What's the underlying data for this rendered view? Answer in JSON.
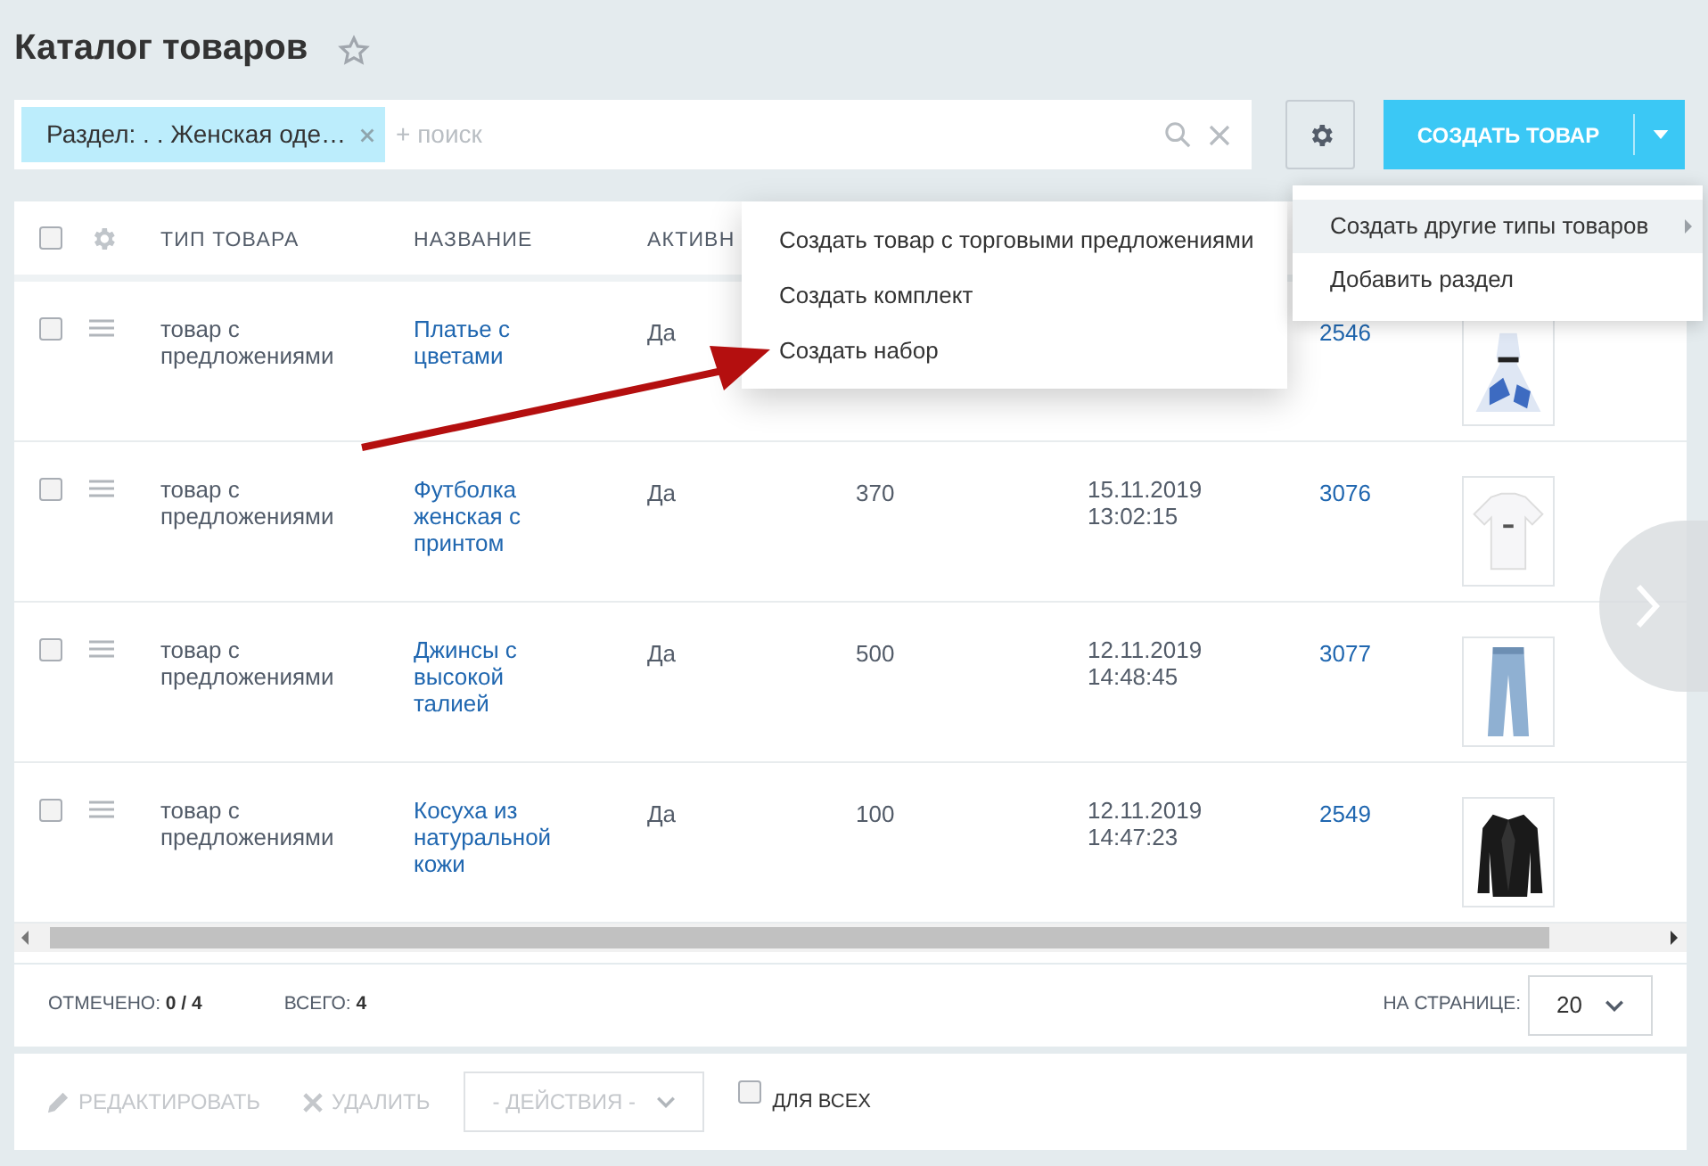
{
  "page_title": "Каталог товаров",
  "filter": {
    "tag": "Раздел: . . Женская оде…",
    "placeholder": "+ поиск"
  },
  "create_button": {
    "label": "СОЗДАТЬ ТОВАР"
  },
  "create_menu": [
    {
      "label": "Создать другие типы товаров",
      "selected": true,
      "has_submenu": true
    },
    {
      "label": "Добавить раздел",
      "selected": false,
      "has_submenu": false
    }
  ],
  "submenu": [
    "Создать товар с торговыми предложениями",
    "Создать комплект",
    "Создать набор"
  ],
  "table": {
    "select_all_checked": false,
    "columns": [
      "ТИП ТОВАРА",
      "НАЗВАНИЕ",
      "АКТИВН"
    ],
    "rows": [
      {
        "checked": false,
        "type": "товар с предложениями",
        "name": "Платье с цветами",
        "active": "Да",
        "id": "2546"
      },
      {
        "checked": false,
        "type": "товар с предложениями",
        "name": "Футболка женская с принтом",
        "active": "Да",
        "price": "370",
        "date": "15.11.2019 13:02:15",
        "id": "3076"
      },
      {
        "checked": false,
        "type": "товар с предложениями",
        "name": "Джинсы с высокой талией",
        "active": "Да",
        "price": "500",
        "date": "12.11.2019 14:48:45",
        "id": "3077"
      },
      {
        "checked": false,
        "type": "товар с предложениями",
        "name": "Косуха из натуральной кожи",
        "active": "Да",
        "price": "100",
        "date": "12.11.2019 14:47:23",
        "id": "2549"
      }
    ]
  },
  "footer": {
    "checked_label": "ОТМЕЧЕНО:",
    "checked_value": "0 / 4",
    "total_label": "ВСЕГО:",
    "total_value": "4",
    "per_page_label": "НА СТРАНИЦЕ:",
    "per_page": "20"
  },
  "actions": {
    "edit": {
      "label": "РЕДАКТИРОВАТЬ",
      "disabled": true
    },
    "delete": {
      "label": "УДАЛИТЬ",
      "disabled": true
    },
    "select": "- ДЕЙСТВИЯ -",
    "for_all": {
      "label": "ДЛЯ ВСЕХ",
      "checked": false
    }
  }
}
